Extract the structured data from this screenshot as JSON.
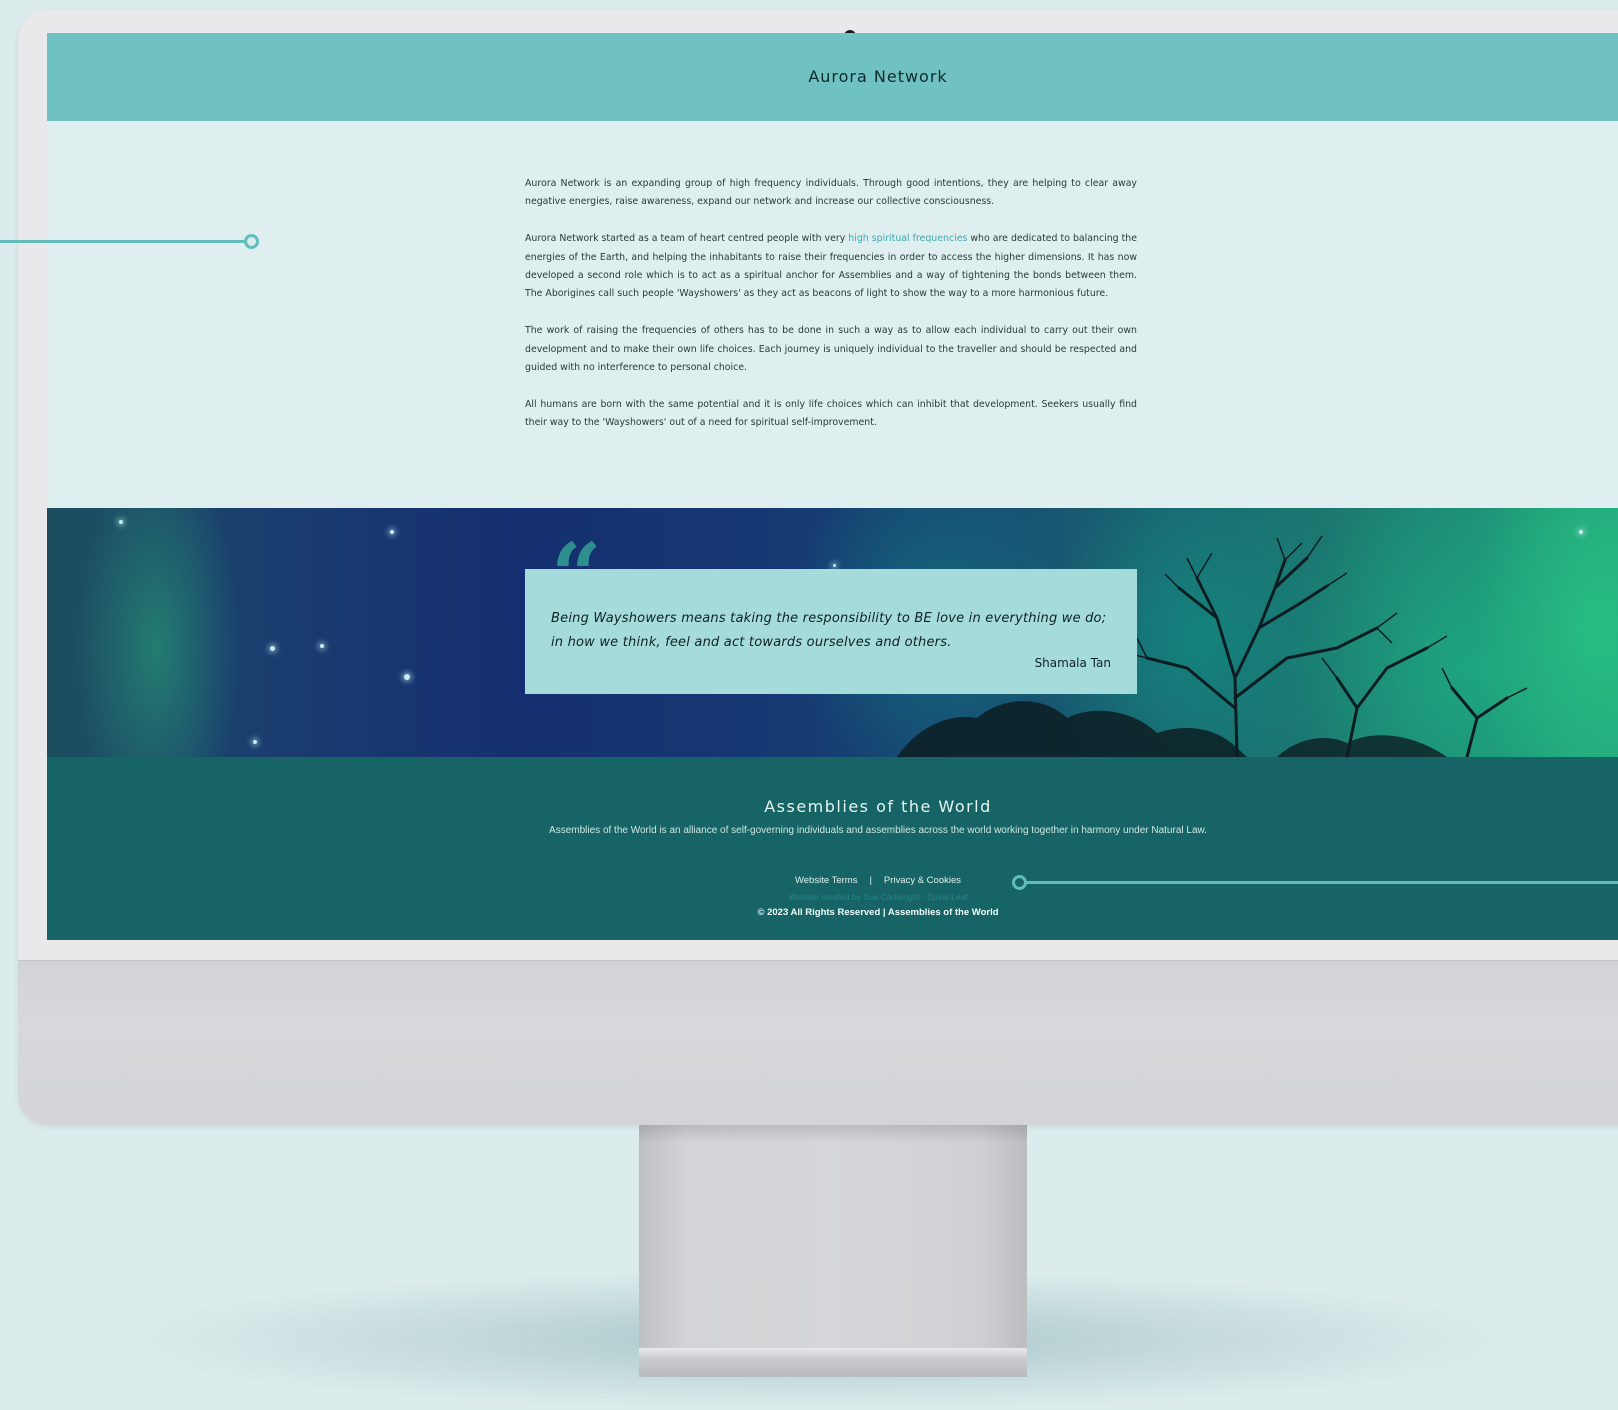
{
  "header": {
    "site_title": "Aurora Network"
  },
  "content": {
    "paragraph_1": "Aurora Network is an expanding group of high frequency individuals. Through good intentions, they are helping to clear away negative energies, raise awareness, expand our network and increase our collective consciousness.",
    "paragraph_2_before_link": "Aurora Network started as a team of heart centred people with very ",
    "paragraph_2_link": "high spiritual frequencies",
    "paragraph_2_after_link": " who are dedicated to balancing the energies of the Earth, and helping the inhabitants to raise their frequencies in order to access the higher dimensions. It has now developed a second role which is to act as a spiritual anchor for Assemblies and a way of tightening the bonds between them. The Aborigines call such people 'Wayshowers' as they act as beacons of light to show the way to a more harmonious future.",
    "paragraph_3": "The work of raising the frequencies of others has to be done in such a way as to allow each individual to carry out their own development and to make their own life choices. Each journey is uniquely individual to the traveller and should be respected and guided with no interference to personal choice.",
    "paragraph_4": "All humans are born with the same potential and it is only life choices which can inhibit that development. Seekers usually find their way to the 'Wayshowers' out of a need for spiritual self-improvement."
  },
  "quote": {
    "mark": "“",
    "text": "Being Wayshowers means taking the responsibility to BE love in everything we do; in how we think, feel and act towards ourselves and others.",
    "author": "Shamala Tan"
  },
  "footer": {
    "title": "Assemblies of the World",
    "description": "Assemblies of the World is an alliance of self-governing individuals and assemblies across the world working together in harmony under Natural Law.",
    "link_terms": "Website Terms",
    "separator": "|",
    "link_privacy": "Privacy & Cookies",
    "credit": "Website created by Sue Cartwright - Spiral Leaf",
    "copyright": "© 2023 All Rights Reserved | Assemblies of the World"
  },
  "colors": {
    "header_bg": "#70c1c1",
    "page_bg": "#dfeeee",
    "accent_link": "#3fa9ad",
    "quote_box": "#a6dbdc",
    "footer_bg": "#166465",
    "connector_line": "#62bcbc"
  }
}
